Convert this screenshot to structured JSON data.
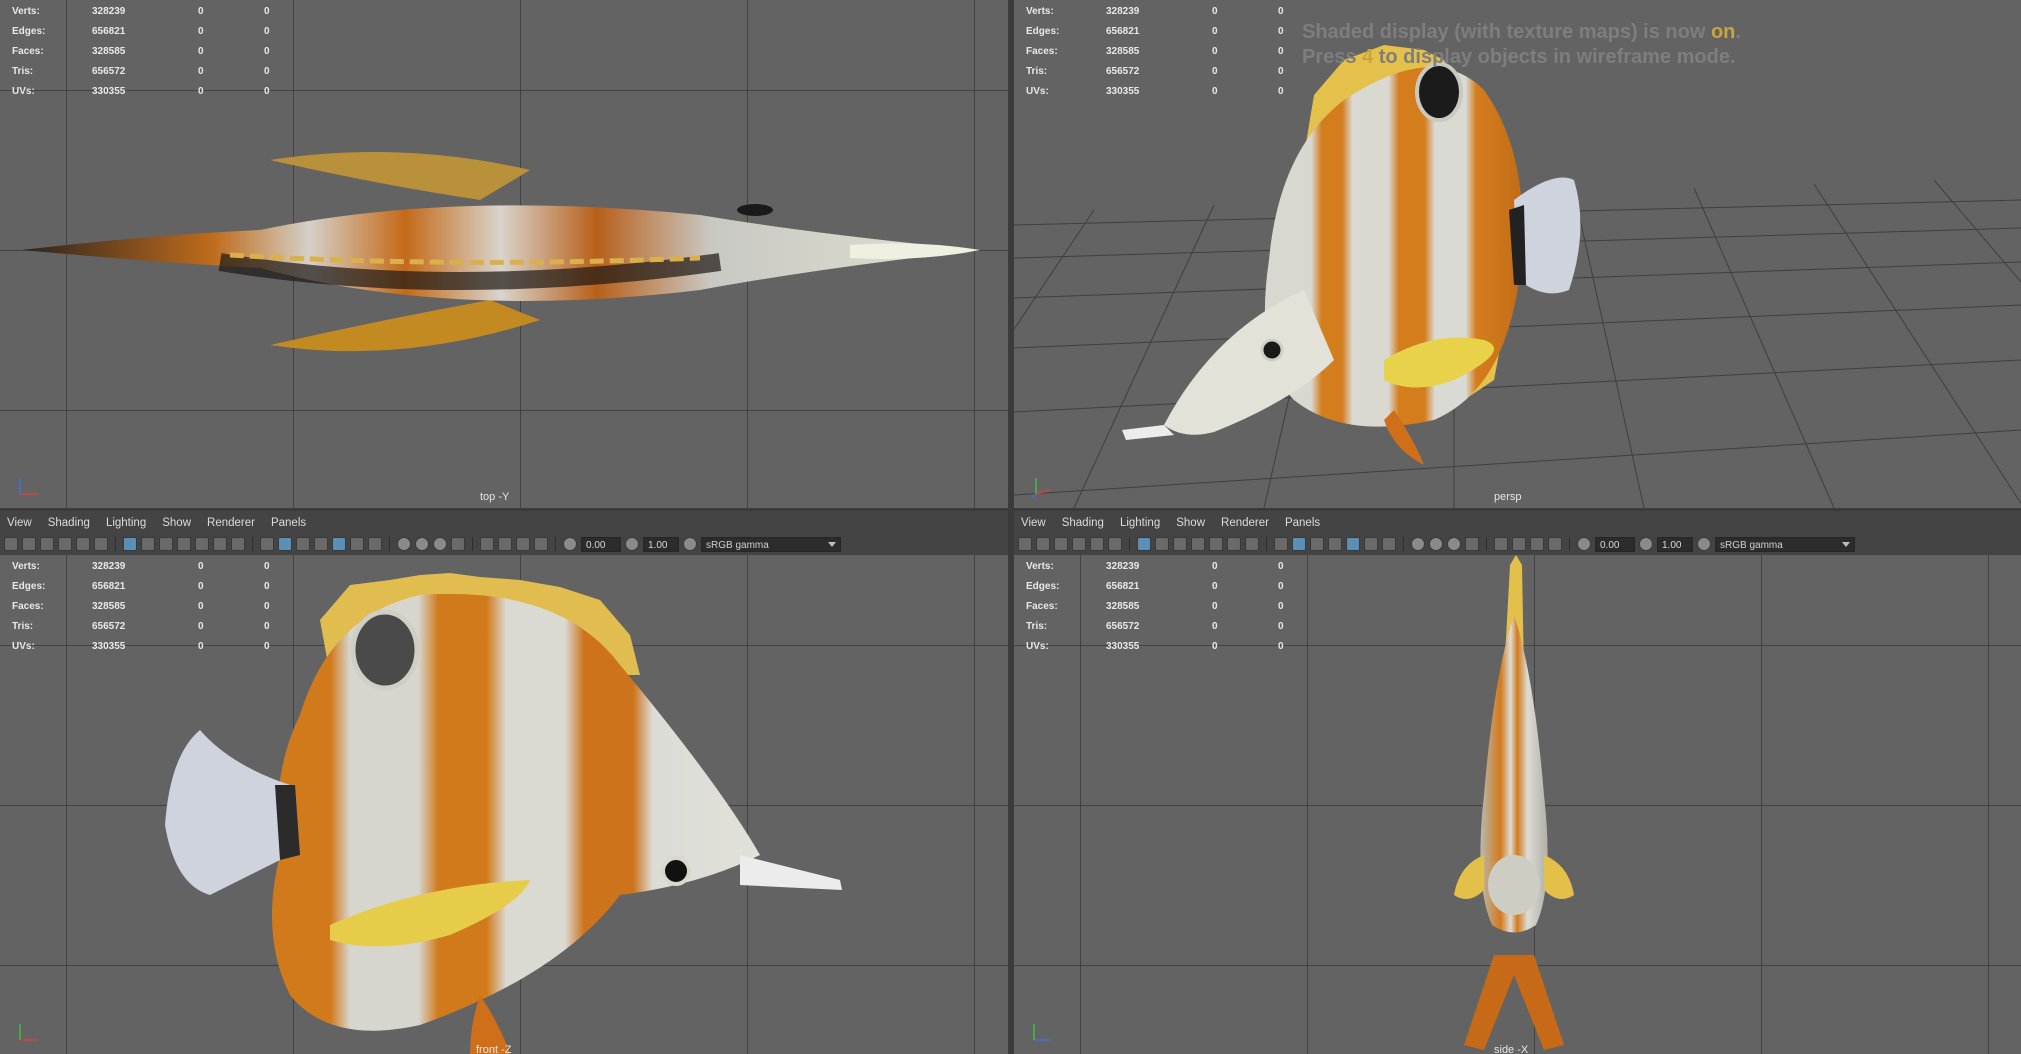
{
  "stats": [
    {
      "label": "Verts:",
      "v1": "328239",
      "v2": "0",
      "v3": "0"
    },
    {
      "label": "Edges:",
      "v1": "656821",
      "v2": "0",
      "v3": "0"
    },
    {
      "label": "Faces:",
      "v1": "328585",
      "v2": "0",
      "v3": "0"
    },
    {
      "label": "Tris:",
      "v1": "656572",
      "v2": "0",
      "v3": "0"
    },
    {
      "label": "UVs:",
      "v1": "330355",
      "v2": "0",
      "v3": "0"
    }
  ],
  "viewports": {
    "top": {
      "camera": "top -Y"
    },
    "persp": {
      "camera": "persp"
    },
    "front": {
      "camera": "front -Z"
    },
    "side": {
      "camera": "side -X"
    }
  },
  "message": {
    "line1_pre": "Shaded display (with texture maps) is now ",
    "line1_hl": "on",
    "line1_post": ".",
    "line2_pre": "Press ",
    "line2_hl": "4",
    "line2_post": " to display objects in wireframe mode."
  },
  "panel_menu": [
    "View",
    "Shading",
    "Lighting",
    "Show",
    "Renderer",
    "Panels"
  ],
  "toolbar": {
    "near_value": "0.00",
    "far_value": "1.00",
    "color_space": "sRGB gamma"
  },
  "colors": {
    "viewport_bg": "#636363",
    "panel_bg": "#444444",
    "highlight": "#c9a63a",
    "fish_orange": "#d9821f",
    "fish_white": "#d8d8d2"
  },
  "icons": {
    "axis_gizmo": "axis-gizmo-icon",
    "dropdown": "chevron-down-icon"
  }
}
